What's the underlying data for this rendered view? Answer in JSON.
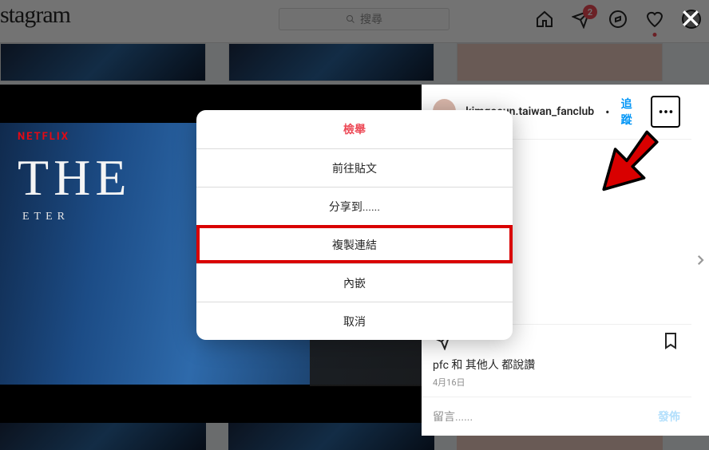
{
  "topbar": {
    "logo_text": "stagram",
    "search_placeholder": "搜尋",
    "badge_count": "2"
  },
  "post": {
    "username": "kimgoeun.taiwan_fanclub",
    "separator": "•",
    "follow_label": "追蹤",
    "media": {
      "brand": "NETFLIX",
      "title": "THE",
      "subtitle": "ETER"
    },
    "likes_text": "pfc 和 其他人 都說讚",
    "date_text": "4月16日",
    "comment_placeholder": "留言......",
    "post_button_label": "發佈"
  },
  "options_menu": {
    "report": "檢舉",
    "go_to_post": "前往貼文",
    "share_to": "分享到......",
    "copy_link": "複製連結",
    "embed": "內嵌",
    "cancel": "取消"
  }
}
